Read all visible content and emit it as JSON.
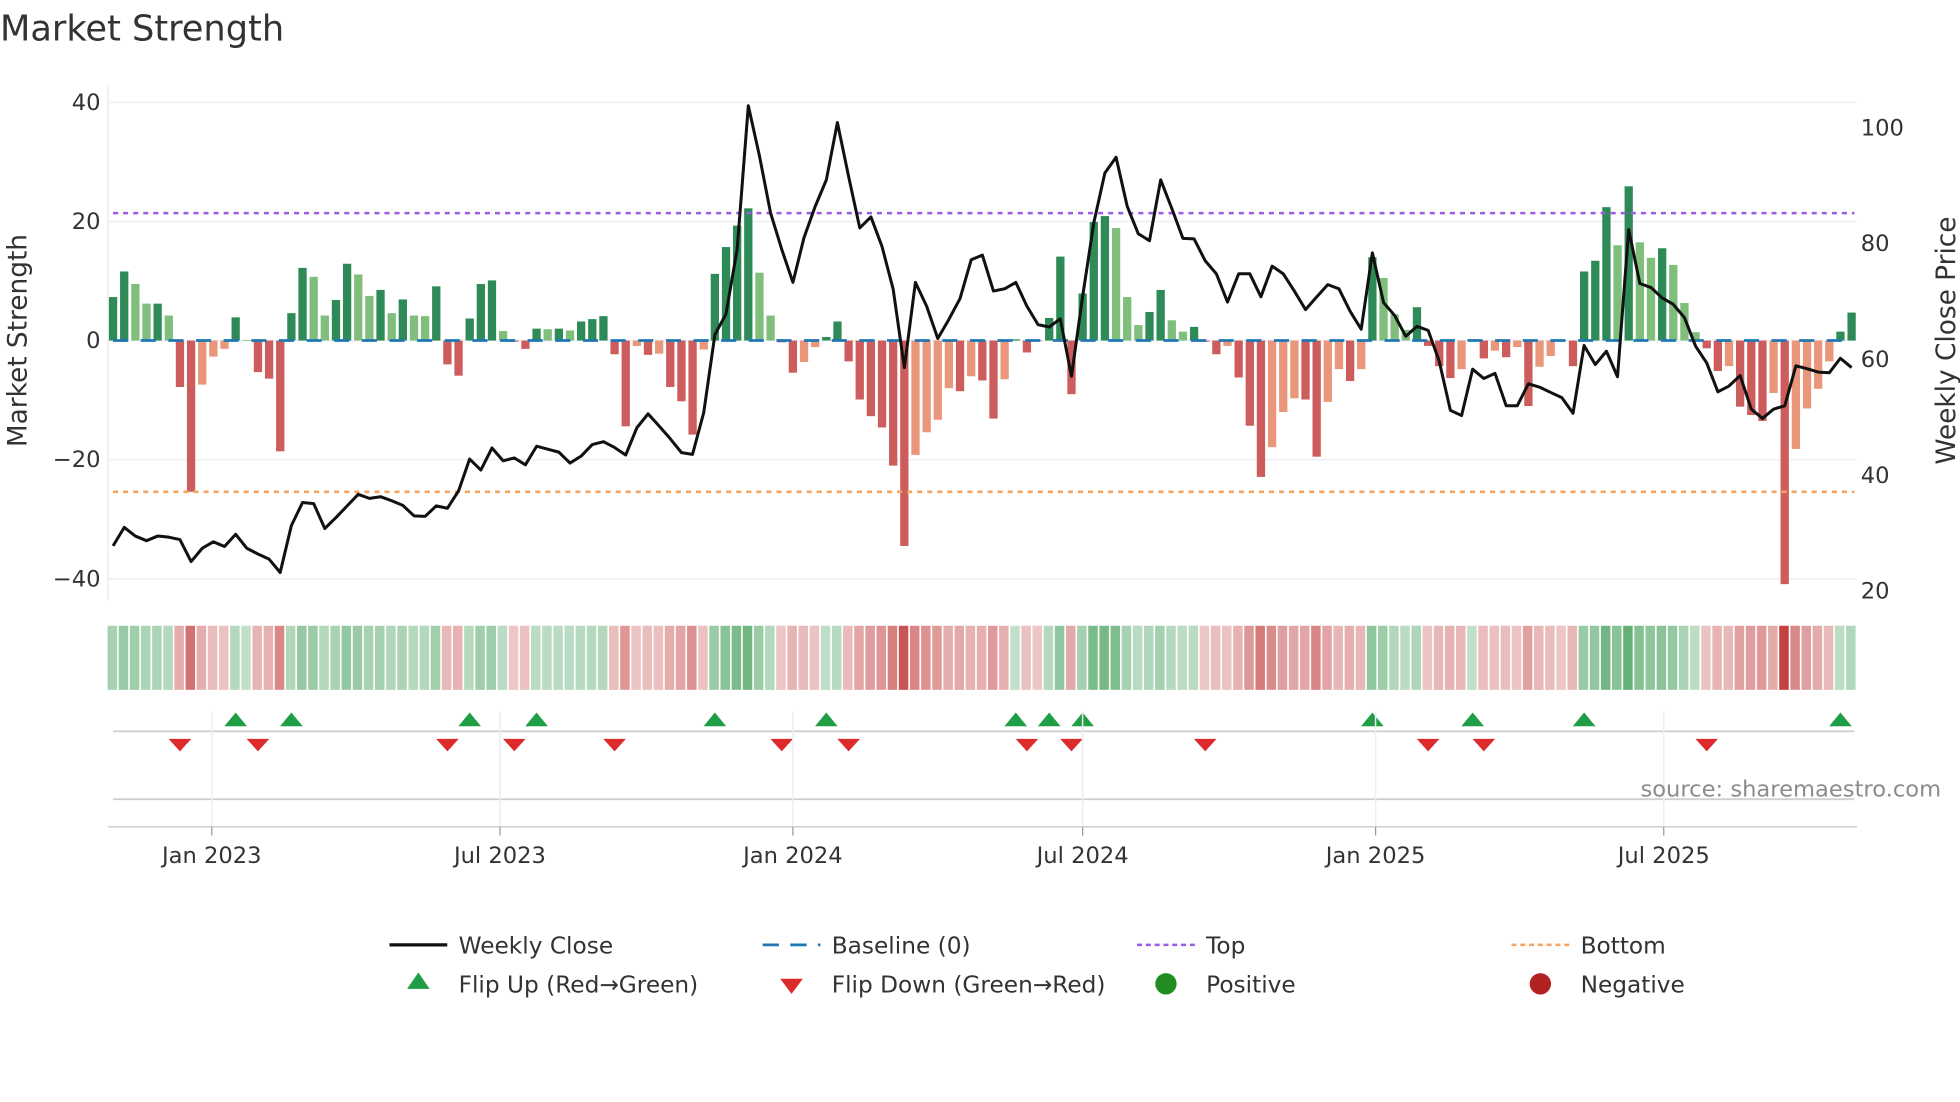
{
  "title": "Market Strength",
  "source": "source: sharemaestro.com",
  "colors": {
    "pos_rising": "#2e8b57",
    "pos_falling": "#7fbf7b",
    "neg_falling": "#cd5c5c",
    "neg_rising": "#e9967a",
    "baseline": "#1f77b4",
    "top": "#9b5de5",
    "bottom": "#f4a460",
    "line": "#111111",
    "flip_up": "#1f9e45",
    "flip_down": "#dd2a2a",
    "positive": "#228b22",
    "negative": "#b22222"
  },
  "legend": [
    {
      "label": "Weekly Close",
      "symbol": "line"
    },
    {
      "label": "Baseline (0)",
      "symbol": "dash"
    },
    {
      "label": "Top",
      "symbol": "dot-purple"
    },
    {
      "label": "Bottom",
      "symbol": "dot-orange"
    },
    {
      "label": "Flip Up (Red→Green)",
      "symbol": "triangle-up"
    },
    {
      "label": "Flip Down (Green→Red)",
      "symbol": "triangle-down"
    },
    {
      "label": "Positive",
      "symbol": "circle-green"
    },
    {
      "label": "Negative",
      "symbol": "circle-red"
    }
  ],
  "chart_data": {
    "type": "bar",
    "title": "Market Strength",
    "ylabel": "Market Strength",
    "y2label": "Weekly Close Price",
    "ylim": [
      -42,
      42
    ],
    "y2lim": [
      17.5,
      108
    ],
    "yticks": [
      "40",
      "20",
      "0",
      "−20",
      "−40"
    ],
    "ytick_values": [
      40,
      20,
      0,
      -20,
      -40
    ],
    "y2ticks": [
      "100",
      "80",
      "60",
      "40",
      "20"
    ],
    "y2tick_values": [
      100,
      80,
      60,
      40,
      20
    ],
    "xticks": [
      {
        "label": "Jan 2023",
        "date": "2023-01-01"
      },
      {
        "label": "Jul 2023",
        "date": "2023-07-01"
      },
      {
        "label": "Jan 2024",
        "date": "2024-01-01"
      },
      {
        "label": "Jul 2024",
        "date": "2024-07-01"
      },
      {
        "label": "Jan 2025",
        "date": "2025-01-01"
      },
      {
        "label": "Jul 2025",
        "date": "2025-07-01"
      }
    ],
    "start_week": "2022-10-31",
    "frequency": "weekly",
    "top_level": 21.4,
    "bottom_level": -25.4,
    "baseline": 0,
    "strength": [
      7.3,
      11.6,
      9.5,
      6.2,
      6.2,
      4.2,
      -7.8,
      -25.4,
      -7.4,
      -2.7,
      -1.4,
      3.9,
      0.1,
      -5.3,
      -6.4,
      -18.6,
      4.6,
      12.2,
      10.7,
      4.2,
      6.8,
      12.9,
      11.1,
      7.5,
      8.5,
      4.6,
      6.9,
      4.2,
      4.1,
      9.1,
      -4.0,
      -5.9,
      3.7,
      9.5,
      10.1,
      1.6,
      -0.2,
      -1.4,
      2.0,
      1.9,
      2.0,
      1.7,
      3.2,
      3.6,
      4.1,
      -2.3,
      -14.4,
      -0.9,
      -2.4,
      -2.2,
      -7.8,
      -10.2,
      -15.8,
      -1.5,
      11.2,
      15.7,
      19.3,
      22.2,
      11.4,
      4.2,
      -0.3,
      -5.4,
      -3.6,
      -1.1,
      0.6,
      3.2,
      -3.5,
      -9.9,
      -12.7,
      -14.6,
      -21.0,
      -34.5,
      -19.2,
      -15.4,
      -13.3,
      -8.0,
      -8.5,
      -6.0,
      -6.7,
      -13.1,
      -6.5,
      0.2,
      -2.0,
      -0.1,
      3.8,
      14.1,
      -9.0,
      7.9,
      19.9,
      20.9,
      18.9,
      7.3,
      2.6,
      4.8,
      8.5,
      3.4,
      1.5,
      2.3,
      -0.2,
      -2.3,
      -0.9,
      -6.2,
      -14.3,
      -22.9,
      -17.9,
      -12.0,
      -9.7,
      -9.9,
      -19.5,
      -10.3,
      -4.8,
      -6.8,
      -4.8,
      14.0,
      10.5,
      4.4,
      1.8,
      5.6,
      -0.9,
      -4.3,
      -6.3,
      -4.8,
      0.2,
      -3.0,
      -1.7,
      -2.8,
      -1.1,
      -11.0,
      -4.4,
      -2.6,
      -0.1,
      -4.3,
      11.6,
      13.4,
      22.4,
      16.0,
      25.9,
      16.5,
      13.9,
      15.5,
      12.7,
      6.3,
      1.4,
      -1.3,
      -5.1,
      -4.3,
      -11.1,
      -12.5,
      -13.5,
      -8.8,
      -40.9,
      -18.2,
      -11.4,
      -8.1,
      -3.5,
      1.5,
      4.7
    ],
    "weekly_close": [
      27.8,
      31.0,
      29.5,
      28.7,
      29.5,
      29.3,
      28.9,
      25.1,
      27.4,
      28.5,
      27.7,
      29.8,
      27.4,
      26.4,
      25.5,
      23.2,
      31.3,
      35.3,
      35.1,
      30.8,
      32.7,
      34.7,
      36.7,
      36.0,
      36.3,
      35.6,
      34.8,
      33.0,
      32.9,
      34.7,
      34.3,
      37.3,
      42.8,
      40.9,
      44.7,
      42.5,
      43.0,
      41.8,
      45.0,
      44.5,
      44.0,
      42.1,
      43.3,
      45.3,
      45.8,
      44.8,
      43.5,
      48.2,
      50.6,
      48.5,
      46.3,
      43.9,
      43.6,
      50.8,
      64.3,
      67.8,
      79.0,
      103.8,
      95.1,
      85.3,
      79.0,
      73.3,
      81.0,
      86.4,
      91.0,
      100.9,
      91.6,
      82.7,
      84.6,
      79.5,
      72.1,
      58.6,
      73.3,
      69.2,
      63.6,
      66.9,
      70.5,
      77.2,
      78.0,
      71.8,
      72.2,
      73.3,
      69.2,
      66.0,
      65.6,
      67.0,
      57.1,
      70.9,
      83.6,
      92.2,
      94.9,
      86.4,
      81.7,
      80.5,
      91.0,
      86.1,
      80.9,
      80.8,
      77.0,
      74.8,
      69.9,
      74.8,
      74.8,
      70.8,
      76.1,
      74.8,
      71.8,
      68.6,
      70.8,
      72.9,
      72.2,
      68.3,
      65.2,
      78.4,
      69.8,
      67.6,
      64.0,
      65.7,
      65.0,
      59.7,
      51.2,
      50.3,
      58.3,
      56.7,
      57.6,
      52.0,
      52.0,
      55.8,
      55.2,
      54.3,
      53.4,
      50.7,
      62.4,
      59.1,
      61.4,
      57.0,
      82.4,
      73.1,
      72.4,
      70.6,
      69.5,
      67.2,
      62.3,
      59.4,
      54.4,
      55.4,
      57.2,
      51.4,
      49.8,
      51.4,
      52.0,
      58.9,
      58.4,
      57.8,
      57.7,
      60.2,
      58.6
    ],
    "legend_position": "bottom-center",
    "grid": true
  }
}
